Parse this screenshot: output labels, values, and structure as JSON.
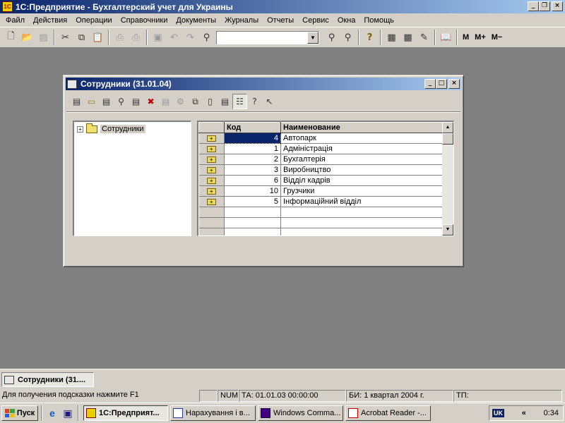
{
  "app": {
    "title": "1С:Предприятие - Бухгалтерский учет для Украины",
    "icon_text": "1С"
  },
  "window_controls": {
    "minimize": "_",
    "restore": "❐",
    "close": "×"
  },
  "menu": [
    "Файл",
    "Действия",
    "Операции",
    "Справочники",
    "Документы",
    "Журналы",
    "Отчеты",
    "Сервис",
    "Окна",
    "Помощь"
  ],
  "toolbar": {
    "search_value": "",
    "m_label": "M",
    "mplus_label": "M+",
    "mminus_label": "M−"
  },
  "child_window": {
    "title": "Сотрудники (31.01.04)",
    "tree": {
      "root_label": "Сотрудники",
      "expander": "+"
    },
    "table": {
      "headers": [
        "",
        "Код",
        "Наименование"
      ],
      "rows": [
        {
          "code": "4",
          "name": "Автопарк"
        },
        {
          "code": "1",
          "name": "Адміністрація"
        },
        {
          "code": "2",
          "name": "Бухгалтерія"
        },
        {
          "code": "3",
          "name": "Виробництво"
        },
        {
          "code": "6",
          "name": "Відділ кадрів"
        },
        {
          "code": "10",
          "name": "Грузчики"
        },
        {
          "code": "5",
          "name": "Інформаційний відділ"
        }
      ],
      "selected_row": 0
    }
  },
  "window_bar": {
    "item_label": "Сотрудники (31...."
  },
  "status": {
    "hint": "Для получения подсказки нажмите F1",
    "num": "NUM",
    "ta": "ТА: 01.01.03  00:00:00",
    "bi": "БИ: 1 квартал 2004 г.",
    "tp": "ТП:"
  },
  "taskbar": {
    "start_label": "Пуск",
    "tasks": [
      "1С:Предприят...",
      "Нарахування і в...",
      "Windows Comma...",
      "Acrobat Reader -..."
    ],
    "lang": "UK",
    "clock": "0:34"
  },
  "colors": {
    "titlebar_start": "#0a246a",
    "titlebar_end": "#a6caf0",
    "face": "#d4d0c8",
    "workspace": "#808080"
  }
}
